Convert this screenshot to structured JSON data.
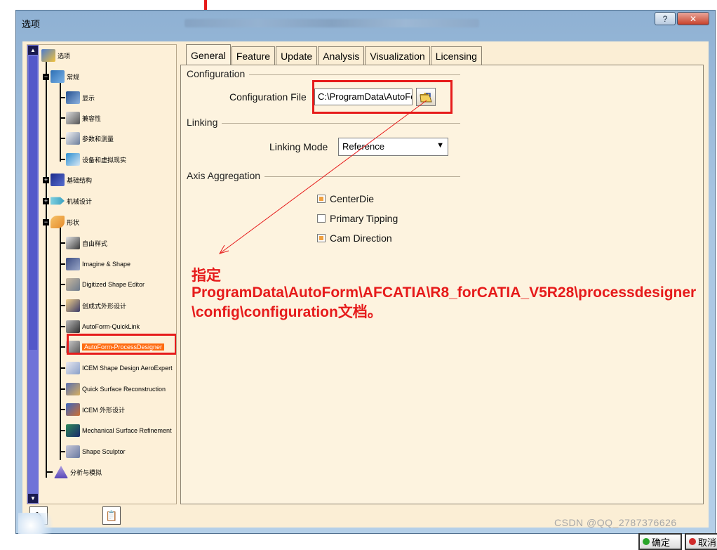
{
  "window": {
    "title": "选项"
  },
  "tree": {
    "items": [
      {
        "label": "选项"
      },
      {
        "label": "常规"
      },
      {
        "label": "显示"
      },
      {
        "label": "兼容性"
      },
      {
        "label": "参数和测量"
      },
      {
        "label": "设备和虚拟现实"
      },
      {
        "label": "基础结构"
      },
      {
        "label": "机械设计"
      },
      {
        "label": "形状"
      },
      {
        "label": "自由样式"
      },
      {
        "label": "Imagine & Shape"
      },
      {
        "label": "Digitized Shape Editor"
      },
      {
        "label": "创成式外形设计"
      },
      {
        "label": "AutoForm-QuickLink"
      },
      {
        "label": "AutoForm-ProcessDesigner"
      },
      {
        "label": "ICEM Shape Design AeroExpert"
      },
      {
        "label": "Quick Surface Reconstruction"
      },
      {
        "label": "ICEM 外形设计"
      },
      {
        "label": "Mechanical Surface Refinement"
      },
      {
        "label": "Shape Sculptor"
      },
      {
        "label": "分析与模拟"
      }
    ],
    "selected": "AutoForm-ProcessDesigner"
  },
  "tabs": [
    "General",
    "Feature",
    "Update",
    "Analysis",
    "Visualization",
    "Licensing"
  ],
  "active_tab": "General",
  "configuration": {
    "group_label": "Configuration",
    "file_label": "Configuration File",
    "file_value": "C:\\ProgramData\\AutoForm"
  },
  "linking": {
    "group_label": "Linking",
    "mode_label": "Linking Mode",
    "mode_value": "Reference"
  },
  "axis": {
    "group_label": "Axis Aggregation",
    "options": [
      {
        "label": "CenterDie",
        "checked": true
      },
      {
        "label": "Primary Tipping",
        "checked": false
      },
      {
        "label": "Cam Direction",
        "checked": true
      }
    ]
  },
  "annotation": {
    "title": "指定",
    "body": "ProgramData\\AutoForm\\AFCATIA\\R8_forCATIA_V5R28\\processdesigner\\config\\configuration文档。"
  },
  "buttons": {
    "ok": "确定",
    "cancel": "取消"
  },
  "watermark": "CSDN @QQ_2787376626",
  "colors": {
    "annotation": "#e61b1b",
    "selection": "#ff6b10",
    "panel_bg": "#fdf3df"
  }
}
